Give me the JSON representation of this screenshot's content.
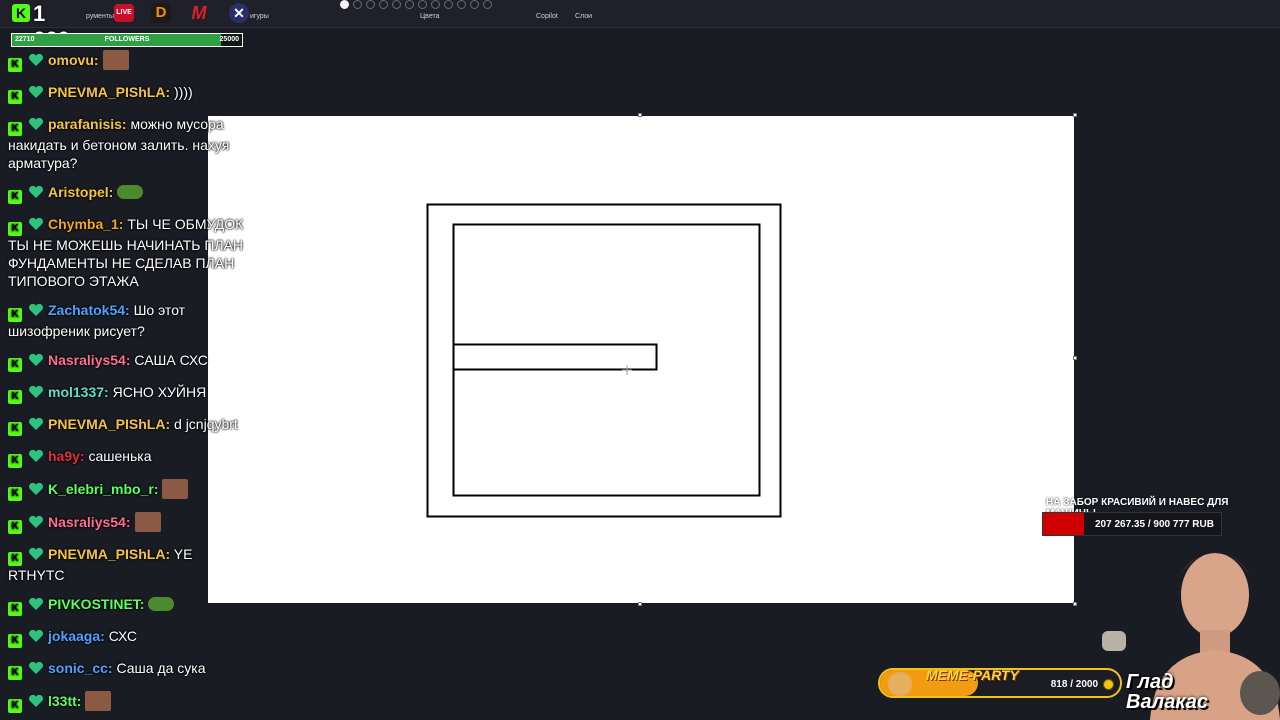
{
  "toolbar": {
    "labels": [
      {
        "key": "brushes_partial",
        "text": "рументы"
      },
      {
        "key": "shapes_partial",
        "text": "игуры"
      },
      {
        "key": "colors",
        "text": "Цвета"
      },
      {
        "key": "copilot",
        "text": "Copilot"
      },
      {
        "key": "layers",
        "text": "Слои"
      }
    ]
  },
  "overlay": {
    "viewer_count": "1 660",
    "live_badge": "LIVE",
    "icons": [
      "kick-logo-icon",
      "live-icon",
      "d-app-icon",
      "m-app-icon",
      "x-app-icon"
    ],
    "followers": {
      "current": "22710",
      "label": "FOLLOWERS",
      "goal": "25000",
      "progress": 0.9084
    }
  },
  "chat": {
    "messages": [
      {
        "user": "omovu:",
        "color": "#f5c542",
        "text": "",
        "emote": "face"
      },
      {
        "user": "PNEVMA_PIShLA:",
        "color": "#f5c542",
        "text": "))))"
      },
      {
        "user": "parafanisis:",
        "color": "#f5c542",
        "text": "можно мусора накидать и бетоном залить. нахуя арматура?"
      },
      {
        "user": "Aristopel:",
        "color": "#f5c542",
        "text": "",
        "emote": "pepe"
      },
      {
        "user": "Chymba_1:",
        "color": "#f5a623",
        "text": "ТЫ ЧЕ ОБМУДОК ТЫ НЕ МОЖЕШЬ НАЧИНАТЬ ПЛАН ФУНДАМЕНТЫ НЕ СДЕЛАВ ПЛАН ТИПОВОГО ЭТАЖА"
      },
      {
        "user": "Zachatok54:",
        "color": "#4da3ff",
        "text": "Шо этот шизофреник рисует?"
      },
      {
        "user": "Nasraliys54:",
        "color": "#ff6f91",
        "text": "САША СХС"
      },
      {
        "user": "mol1337:",
        "color": "#5de0c6",
        "text": "ЯСНО ХУЙНЯ"
      },
      {
        "user": "PNEVMA_PIShLA:",
        "color": "#f5c542",
        "text": "d jcnjqybrt"
      },
      {
        "user": "ha9y:",
        "color": "#e0303a",
        "text": "сашенька"
      },
      {
        "user": "K_elebri_mbo_r:",
        "color": "#5dff5d",
        "text": "",
        "emote": "face"
      },
      {
        "user": "Nasraliys54:",
        "color": "#ff6f91",
        "text": "",
        "emote": "face"
      },
      {
        "user": "PNEVMA_PIShLA:",
        "color": "#f5c542",
        "text": "YE RTHYTC"
      },
      {
        "user": "PIVKOSTINET:",
        "color": "#5dff5d",
        "text": "",
        "emote": "pepe"
      },
      {
        "user": "jokaaga:",
        "color": "#4da3ff",
        "text": "СХС"
      },
      {
        "user": "sonic_cc:",
        "color": "#4da3ff",
        "text": "Саша да сука"
      },
      {
        "user": "l33tt:",
        "color": "#5dff5d",
        "text": "",
        "emote": "face"
      }
    ]
  },
  "donation_goal": {
    "title": "НА ЗАБОР КРАСИВИЙ И НАВЕС ДЛЯ МАШИНЫ",
    "amount": "207 267.35 / 900 777 RUB",
    "progress": 0.23,
    "color": "#d10000"
  },
  "meme_party": {
    "title": "MEME-PARTY",
    "count": "818 / 2000",
    "progress": 0.409
  },
  "streamer": {
    "name_line1": "Глад",
    "name_line2": "Валакас"
  },
  "colors": {
    "kick_green": "#53fc18",
    "background": "#1a1c24",
    "canvas": "#ffffff"
  }
}
